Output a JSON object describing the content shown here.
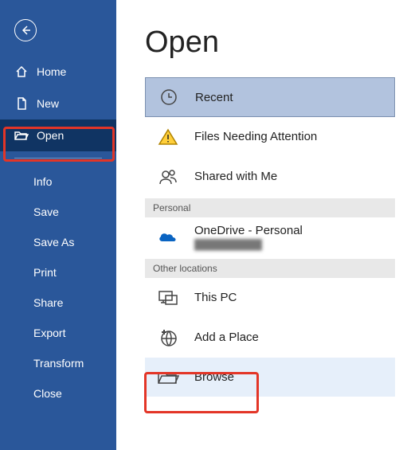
{
  "sidebar": {
    "items": [
      {
        "label": "Home"
      },
      {
        "label": "New"
      },
      {
        "label": "Open"
      }
    ],
    "sub": [
      {
        "label": "Info"
      },
      {
        "label": "Save"
      },
      {
        "label": "Save As"
      },
      {
        "label": "Print"
      },
      {
        "label": "Share"
      },
      {
        "label": "Export"
      },
      {
        "label": "Transform"
      },
      {
        "label": "Close"
      }
    ]
  },
  "main": {
    "title": "Open",
    "sections": {
      "personal": "Personal",
      "other": "Other locations"
    },
    "items": {
      "recent": "Recent",
      "attention": "Files Needing Attention",
      "shared": "Shared with Me",
      "onedrive": "OneDrive - Personal",
      "onedrive_sub": "██████████",
      "thispc": "This PC",
      "addplace": "Add a Place",
      "browse": "Browse"
    }
  }
}
